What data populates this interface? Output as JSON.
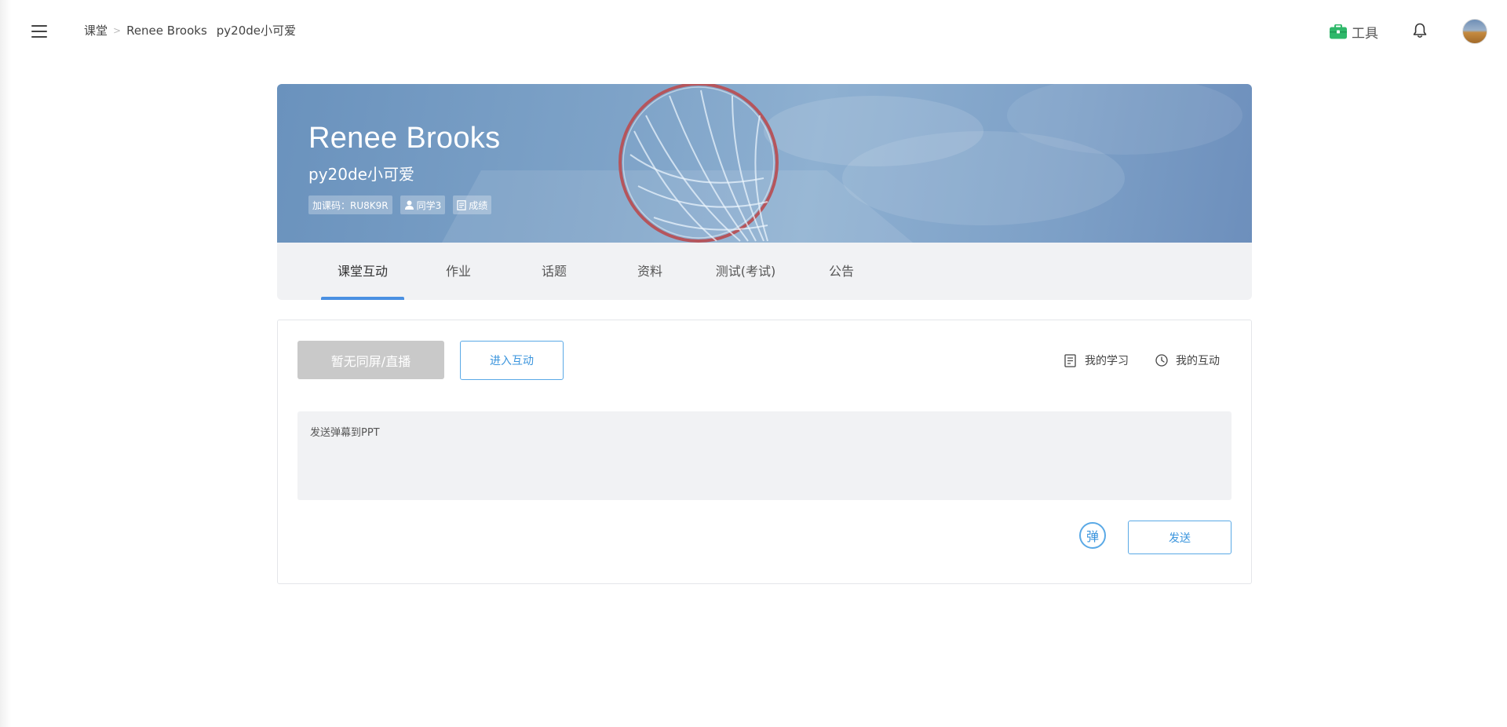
{
  "topbar": {
    "breadcrumb": {
      "root": "课堂",
      "separator": ">",
      "course": "Renee Brooks",
      "class": "py20de小可爱"
    },
    "tools_label": "工具",
    "tools_icon": "toolbox-icon",
    "bell_icon": "bell-icon"
  },
  "course": {
    "title": "Renee Brooks",
    "subtitle": "py20de小可爱",
    "join_code": "加课码：RU8K9R",
    "classmates": "同学3",
    "grades": "成绩"
  },
  "tabs": [
    {
      "label": "课堂互动",
      "active": true
    },
    {
      "label": "作业",
      "active": false
    },
    {
      "label": "话题",
      "active": false
    },
    {
      "label": "资料",
      "active": false
    },
    {
      "label": "测试(考试)",
      "active": false
    },
    {
      "label": "公告",
      "active": false
    }
  ],
  "interaction": {
    "live_button": "暂无同屏/直播",
    "enter_button": "进入互动",
    "my_study": "我的学习",
    "my_interaction": "我的互动",
    "danmu_placeholder": "发送弹幕到PPT",
    "danmu_toggle": "弹",
    "send_button": "发送"
  },
  "colors": {
    "accent": "#4a90e2",
    "link_blue": "#3b95dd",
    "tool_green": "#2fb86a",
    "disabled_gray": "#c9c9c9"
  }
}
